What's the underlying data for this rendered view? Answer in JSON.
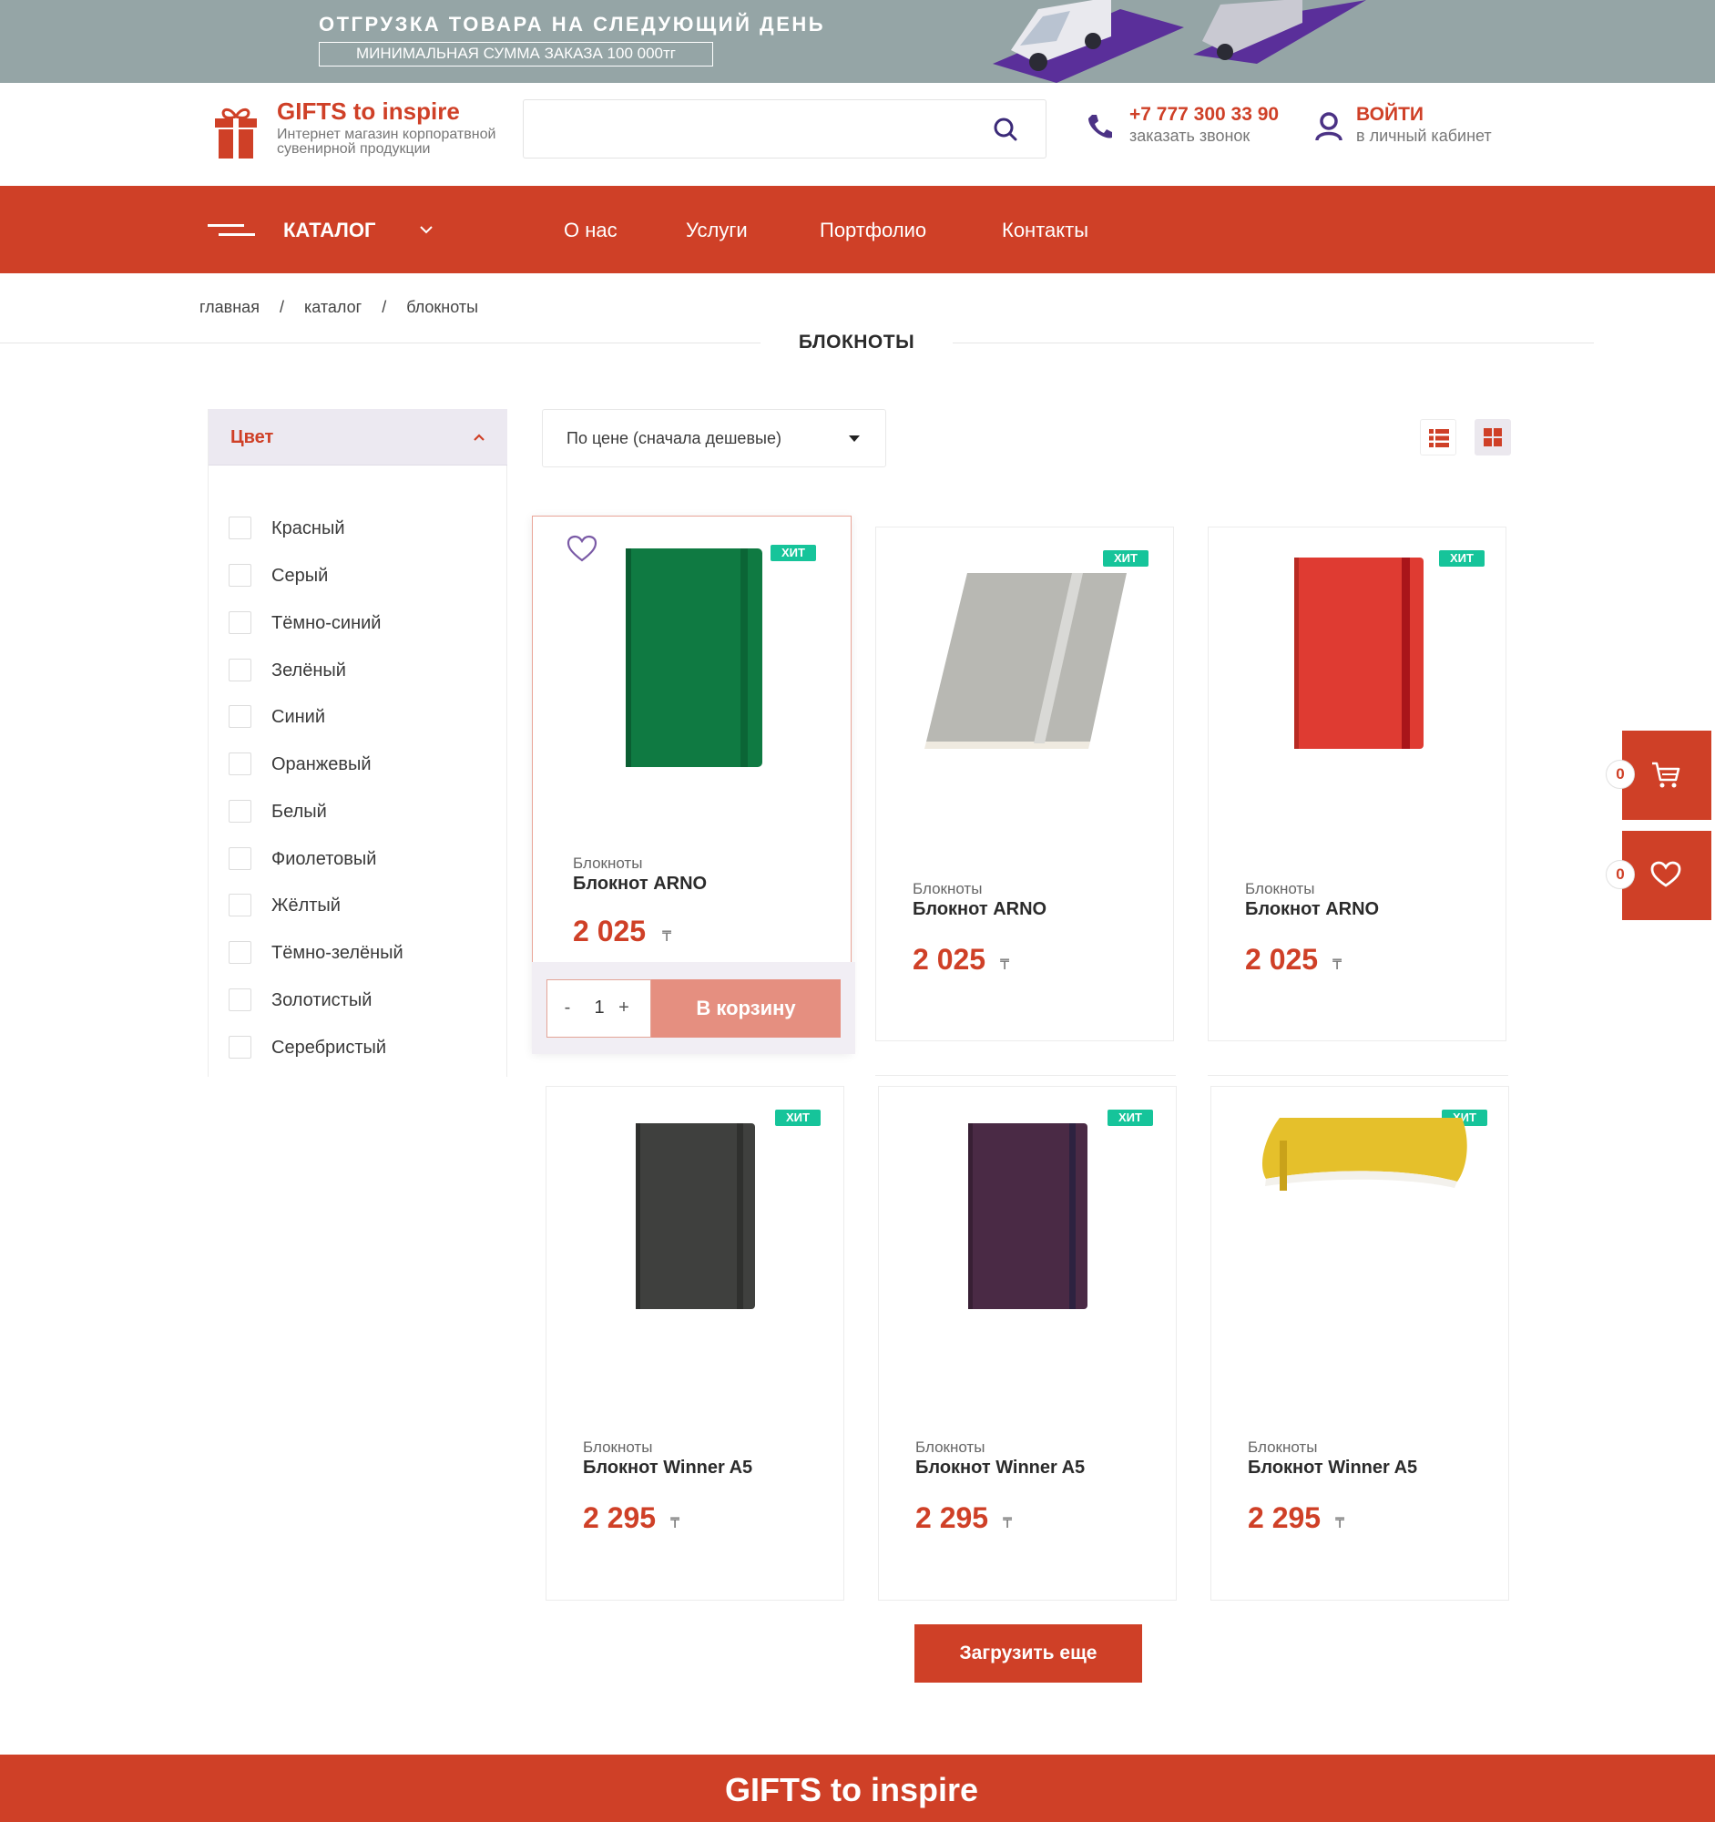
{
  "promo": {
    "title": "ОТГРУЗКА ТОВАРА НА СЛЕДУЮЩИЙ ДЕНЬ",
    "subtitle": "МИНИМАЛЬНАЯ СУММА ЗАКАЗА 100 000тг"
  },
  "header": {
    "logo_title": "GIFTS to inspire",
    "logo_subtitle": "Интернет магазин корпоратвной сувенирной продукции",
    "search_value": "",
    "phone": "+7 777 300 33 90",
    "phone_sub": "заказать звонок",
    "login": "ВОЙТИ",
    "login_sub": "в личный кабинет"
  },
  "nav": {
    "catalog": "КАТАЛОГ",
    "links": [
      "О нас",
      "Услуги",
      "Портфолио",
      "Контакты"
    ]
  },
  "breadcrumbs": [
    "главная",
    "каталог",
    "блокноты"
  ],
  "breadcrumb_sep": "/",
  "page_title": "БЛОКНОТЫ",
  "filter": {
    "title": "Цвет",
    "options": [
      "Красный",
      "Серый",
      "Тёмно-синий",
      "Зелёный",
      "Синий",
      "Оранжевый",
      "Белый",
      "Фиолетовый",
      "Жёлтый",
      "Тёмно-зелёный",
      "Золотистый",
      "Серебристый"
    ]
  },
  "sort": {
    "selected": "По цене (сначала дешевые)"
  },
  "products": [
    {
      "badge": "ХИТ",
      "category": "Блокноты",
      "name": "Блокнот ARNO",
      "price": "2 025",
      "currency": "₸",
      "color": "#0f7a42"
    },
    {
      "badge": "ХИТ",
      "category": "Блокноты",
      "name": "Блокнот ARNO",
      "price": "2 025",
      "currency": "₸",
      "color": "#b8b8b3"
    },
    {
      "badge": "ХИТ",
      "category": "Блокноты",
      "name": "Блокнот ARNO",
      "price": "2 025",
      "currency": "₸",
      "color": "#df3b32"
    },
    {
      "badge": "ХИТ",
      "category": "Блокноты",
      "name": "Блокнот Winner A5",
      "price": "2 295",
      "currency": "₸",
      "color": "#3f403e"
    },
    {
      "badge": "ХИТ",
      "category": "Блокноты",
      "name": "Блокнот Winner A5",
      "price": "2 295",
      "currency": "₸",
      "color": "#4a2a45"
    },
    {
      "badge": "ХИТ",
      "category": "Блокноты",
      "name": "Блокнот Winner A5",
      "price": "2 295",
      "currency": "₸",
      "color": "#e5c02b"
    }
  ],
  "buy": {
    "qty": "1",
    "minus": "-",
    "plus": "+",
    "button": "В корзину"
  },
  "floating": {
    "cart_count": "0",
    "fav_count": "0"
  },
  "load_more": "Загрузить еще",
  "footer": {
    "title": "GIFTS to inspire"
  },
  "colors": {
    "accent": "#cf4027",
    "badge": "#16c49a",
    "banner": "#95a5a6",
    "filter_head": "#ece9f1"
  }
}
